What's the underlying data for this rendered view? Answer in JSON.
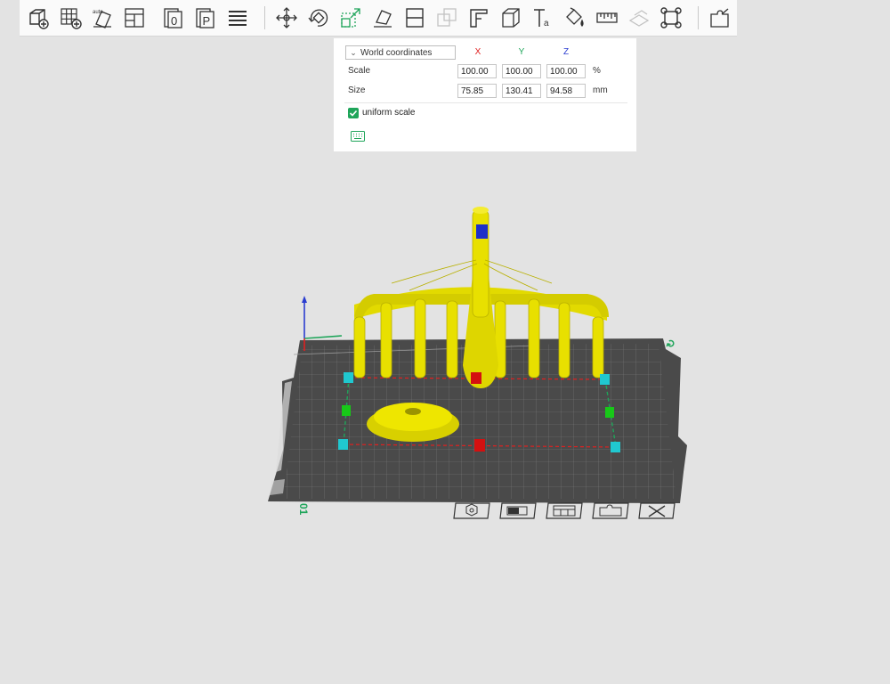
{
  "toolbar": {
    "buttons": [
      {
        "name": "add-object-icon"
      },
      {
        "name": "add-plate-icon"
      },
      {
        "name": "auto-orient-icon"
      },
      {
        "name": "arrange-icon"
      },
      {
        "name": "split-objects-icon"
      },
      {
        "name": "split-parts-icon"
      },
      {
        "name": "layers-icon"
      },
      {
        "name": "move-icon"
      },
      {
        "name": "rotate-icon"
      },
      {
        "name": "scale-icon"
      },
      {
        "name": "lay-on-face-icon"
      },
      {
        "name": "cut-icon"
      },
      {
        "name": "boolean-icon"
      },
      {
        "name": "support-paint-icon"
      },
      {
        "name": "seam-paint-icon"
      },
      {
        "name": "text-emboss-icon"
      },
      {
        "name": "color-paint-icon"
      },
      {
        "name": "measure-icon"
      },
      {
        "name": "assembly-icon"
      },
      {
        "name": "brim-ears-icon"
      },
      {
        "name": "assembly-view-icon"
      }
    ]
  },
  "scale_panel": {
    "coord_system": "World coordinates",
    "axes": {
      "x": "X",
      "y": "Y",
      "z": "Z"
    },
    "colors": {
      "x": "#e02020",
      "y": "#1fa55a",
      "z": "#2a3cd0",
      "checkbox": "#1fa55a"
    },
    "scale_label": "Scale",
    "size_label": "Size",
    "scale": {
      "x": "100.00",
      "y": "100.00",
      "z": "100.00",
      "unit": "%"
    },
    "size": {
      "x": "75.85",
      "y": "130.41",
      "z": "94.58",
      "unit": "mm"
    },
    "uniform_scale_label": "uniform scale",
    "uniform_scale_checked": true,
    "keyboard_icon": "keyboard-icon"
  },
  "viewport": {
    "plate_number": "01",
    "model_color": "#e8e000",
    "plate_buttons": [
      {
        "name": "plate-slice-icon"
      },
      {
        "name": "plate-lock-icon"
      },
      {
        "name": "plate-arrange-icon"
      },
      {
        "name": "plate-settings-icon"
      },
      {
        "name": "plate-close-icon"
      }
    ]
  }
}
